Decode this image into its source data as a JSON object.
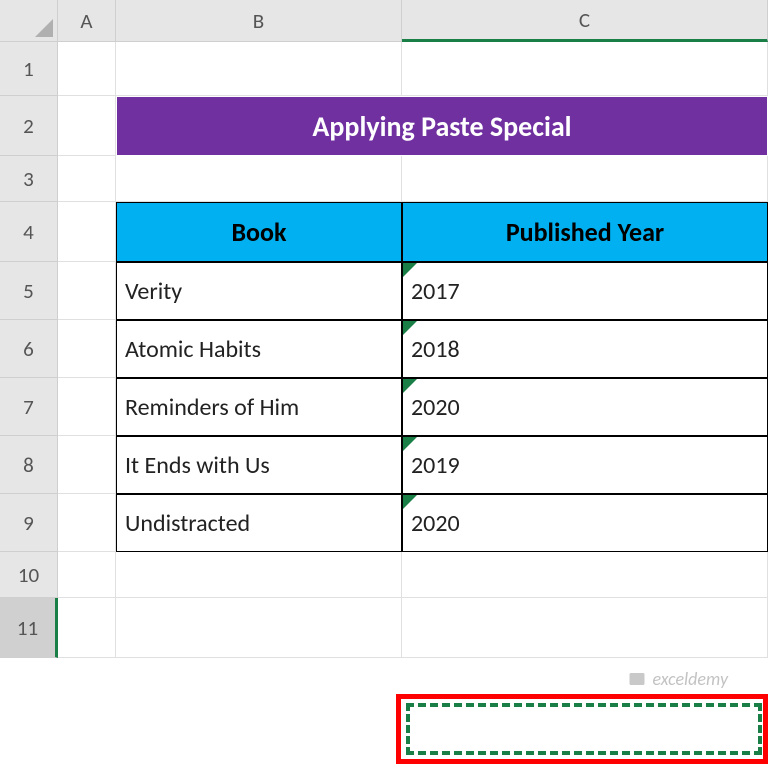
{
  "columns": [
    "A",
    "B",
    "C"
  ],
  "rows": [
    "1",
    "2",
    "3",
    "4",
    "5",
    "6",
    "7",
    "8",
    "9",
    "10",
    "11"
  ],
  "title": "Applying Paste Special",
  "headers": {
    "book": "Book",
    "year": "Published Year"
  },
  "data": [
    {
      "book": "Verity",
      "year": "2017"
    },
    {
      "book": "Atomic Habits",
      "year": "2018"
    },
    {
      "book": "Reminders of Him",
      "year": "2020"
    },
    {
      "book": "It Ends with Us",
      "year": "2019"
    },
    {
      "book": "Undistracted",
      "year": "2020"
    }
  ],
  "watermark": "exceldemy",
  "chart_data": {
    "type": "table",
    "title": "Applying Paste Special",
    "columns": [
      "Book",
      "Published Year"
    ],
    "rows": [
      [
        "Verity",
        2017
      ],
      [
        "Atomic Habits",
        2018
      ],
      [
        "Reminders of Him",
        2020
      ],
      [
        "It Ends with Us",
        2019
      ],
      [
        "Undistracted",
        2020
      ]
    ]
  }
}
